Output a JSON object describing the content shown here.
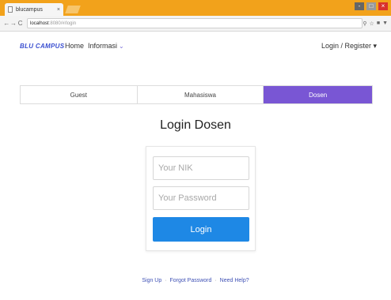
{
  "browser": {
    "tab_title": "blucampus",
    "url_host": "localhost",
    "url_path": ":8080/#/login"
  },
  "navbar": {
    "brand": "BLU CAMPUS",
    "home": "Home",
    "informasi": "Informasi",
    "login_register": "Login / Register ▾"
  },
  "roles": {
    "guest": "Guest",
    "mahasiswa": "Mahasiswa",
    "dosen": "Dosen",
    "active": "Dosen"
  },
  "login": {
    "title": "Login Dosen",
    "nik_placeholder": "Your NIK",
    "password_placeholder": "Your Password",
    "button": "Login"
  },
  "footer": {
    "signup": "Sign Up",
    "forgot": "Forgot Password",
    "help": "Need Help?",
    "separator": "·"
  },
  "colors": {
    "accent_purple": "#7956d4",
    "button_blue": "#1e88e5",
    "brand_blue": "#3a4fd0",
    "titlebar_orange": "#f2a21b"
  }
}
